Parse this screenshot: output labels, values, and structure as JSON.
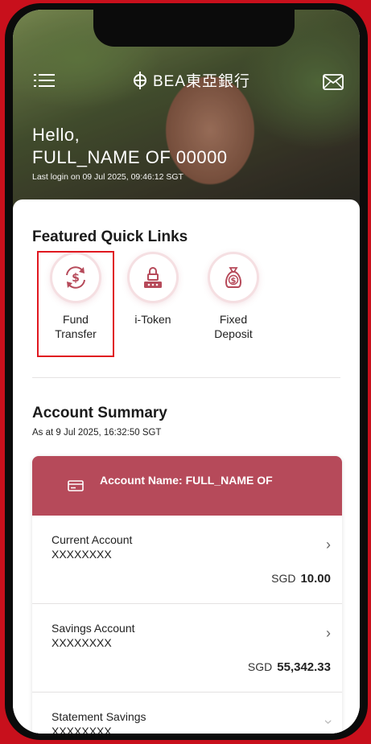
{
  "header": {
    "logo_text": "BEA東亞銀行",
    "greeting": "Hello,",
    "user_name": "FULL_NAME OF 00000",
    "last_login": "Last login on 09 Jul 2025, 09:46:12 SGT"
  },
  "quick_links": {
    "title": "Featured Quick Links",
    "items": [
      {
        "label_line1": "Fund",
        "label_line2": "Transfer",
        "icon": "dollar-transfer-icon"
      },
      {
        "label_line1": "i-Token",
        "label_line2": "",
        "icon": "token-lock-icon"
      },
      {
        "label_line1": "Fixed",
        "label_line2": "Deposit",
        "icon": "money-bag-icon"
      }
    ]
  },
  "account_summary": {
    "title": "Account Summary",
    "as_at": "As at 9 Jul 2025, 16:32:50 SGT",
    "account_name": "Account Name: FULL_NAME OF",
    "accounts": [
      {
        "type": "Current Account",
        "number": "XXXXXXXX",
        "currency": "SGD",
        "balance": "10.00"
      },
      {
        "type": "Savings Account",
        "number": "XXXXXXXX",
        "currency": "SGD",
        "balance": "55,342.33"
      },
      {
        "type": "Statement Savings",
        "number": "XXXXXXXX",
        "currency": "",
        "balance": ""
      }
    ]
  },
  "colors": {
    "brand_red": "#c8101c",
    "account_header": "#b64a5a",
    "highlight": "#e01820"
  }
}
